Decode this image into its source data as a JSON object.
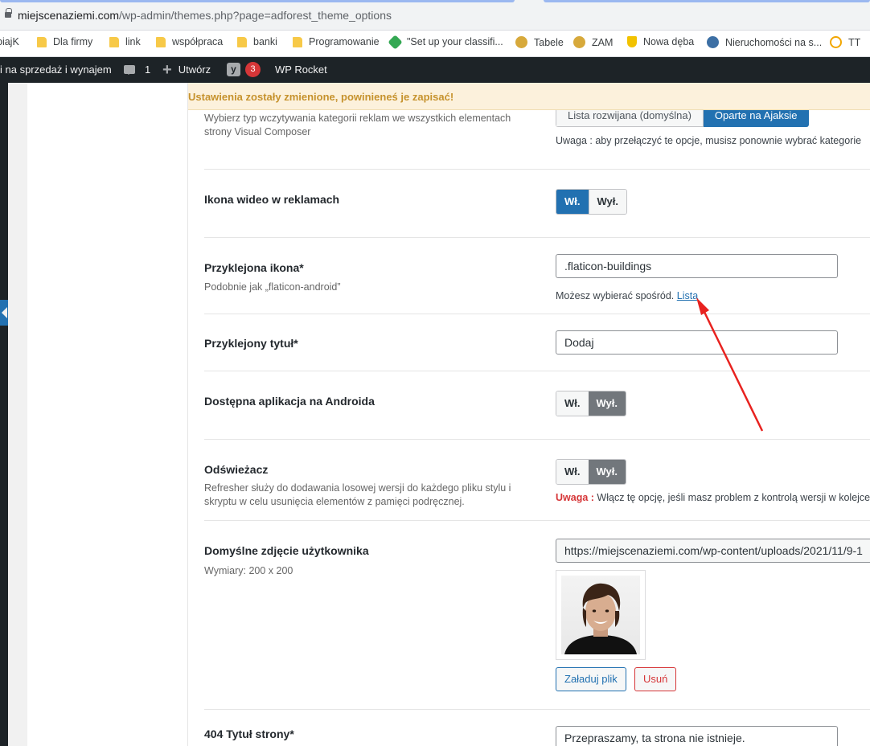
{
  "browser": {
    "url_domain": "miejscenaziemi.com",
    "url_path": "/wp-admin/themes.php?page=adforest_theme_options",
    "bookmarks": [
      {
        "label": "biajK",
        "icon": "folder-icon"
      },
      {
        "label": "Dla firmy",
        "icon": "folder-icon"
      },
      {
        "label": "link",
        "icon": "folder-icon"
      },
      {
        "label": "współpraca",
        "icon": "folder-icon"
      },
      {
        "label": "banki",
        "icon": "folder-icon"
      },
      {
        "label": "Programowanie",
        "icon": "folder-icon"
      },
      {
        "label": "\"Set up your classifi...",
        "icon": "tag-icon"
      },
      {
        "label": "Tabele",
        "icon": "puzzle-icon"
      },
      {
        "label": "ZAM",
        "icon": "puzzle-icon"
      },
      {
        "label": "Nowa dęba",
        "icon": "shield-icon"
      },
      {
        "label": "Nieruchomości na s...",
        "icon": "wordpress-icon"
      },
      {
        "label": "TT",
        "icon": "check-icon"
      }
    ]
  },
  "adminbar": {
    "site": "i na sprzedaż i wynajem",
    "comments": "1",
    "new": "Utwórz",
    "yoast_count": "3",
    "rocket": "WP Rocket"
  },
  "notice": "Ustawienia zostały zmienione, powinieneś je zapisać!",
  "rows": {
    "category": {
      "desc": "Wybierz typ wczytywania kategorii reklam we wszystkich elementach strony Visual Composer",
      "opt_a": "Lista rozwijana (domyślna)",
      "opt_b": "Oparte na Ajaksie",
      "note": "Uwaga : aby przełączyć te opcje, musisz ponownie wybrać kategorie"
    },
    "video": {
      "title": "Ikona wideo w reklamach",
      "on": "Wł.",
      "off": "Wył."
    },
    "sticky_icon": {
      "title": "Przyklejona ikona*",
      "desc": "Podobnie jak „flaticon-android”",
      "value": ".flaticon-buildings",
      "note": "Możesz wybierać spośród.",
      "link": "Lista"
    },
    "sticky_title": {
      "title": "Przyklejony tytuł*",
      "value": "Dodaj"
    },
    "android": {
      "title": "Dostępna aplikacja na Androida",
      "on": "Wł.",
      "off": "Wył."
    },
    "refresher": {
      "title": "Odświeżacz",
      "desc": "Refresher służy do dodawania losowej wersji do każdego pliku stylu i skryptu w celu usunięcia elementów z pamięci podręcznej.",
      "on": "Wł.",
      "off": "Wył.",
      "warn_label": "Uwaga :",
      "warn_text": "Włącz tę opcję, jeśli masz problem z kontrolą wersji w kolejce"
    },
    "avatar": {
      "title": "Domyślne zdjęcie użytkownika",
      "desc": "Wymiary: 200 x 200",
      "url": "https://miejscenaziemi.com/wp-content/uploads/2021/11/9-1",
      "upload": "Załaduj plik",
      "remove": "Usuń"
    },
    "page404": {
      "title": "404 Tytuł strony*",
      "value": "Przepraszamy, ta strona nie istnieje."
    }
  },
  "colors": {
    "accent": "#2271b1",
    "annotation_arrow": "#e8221f",
    "notice_text": "#c6922d"
  }
}
